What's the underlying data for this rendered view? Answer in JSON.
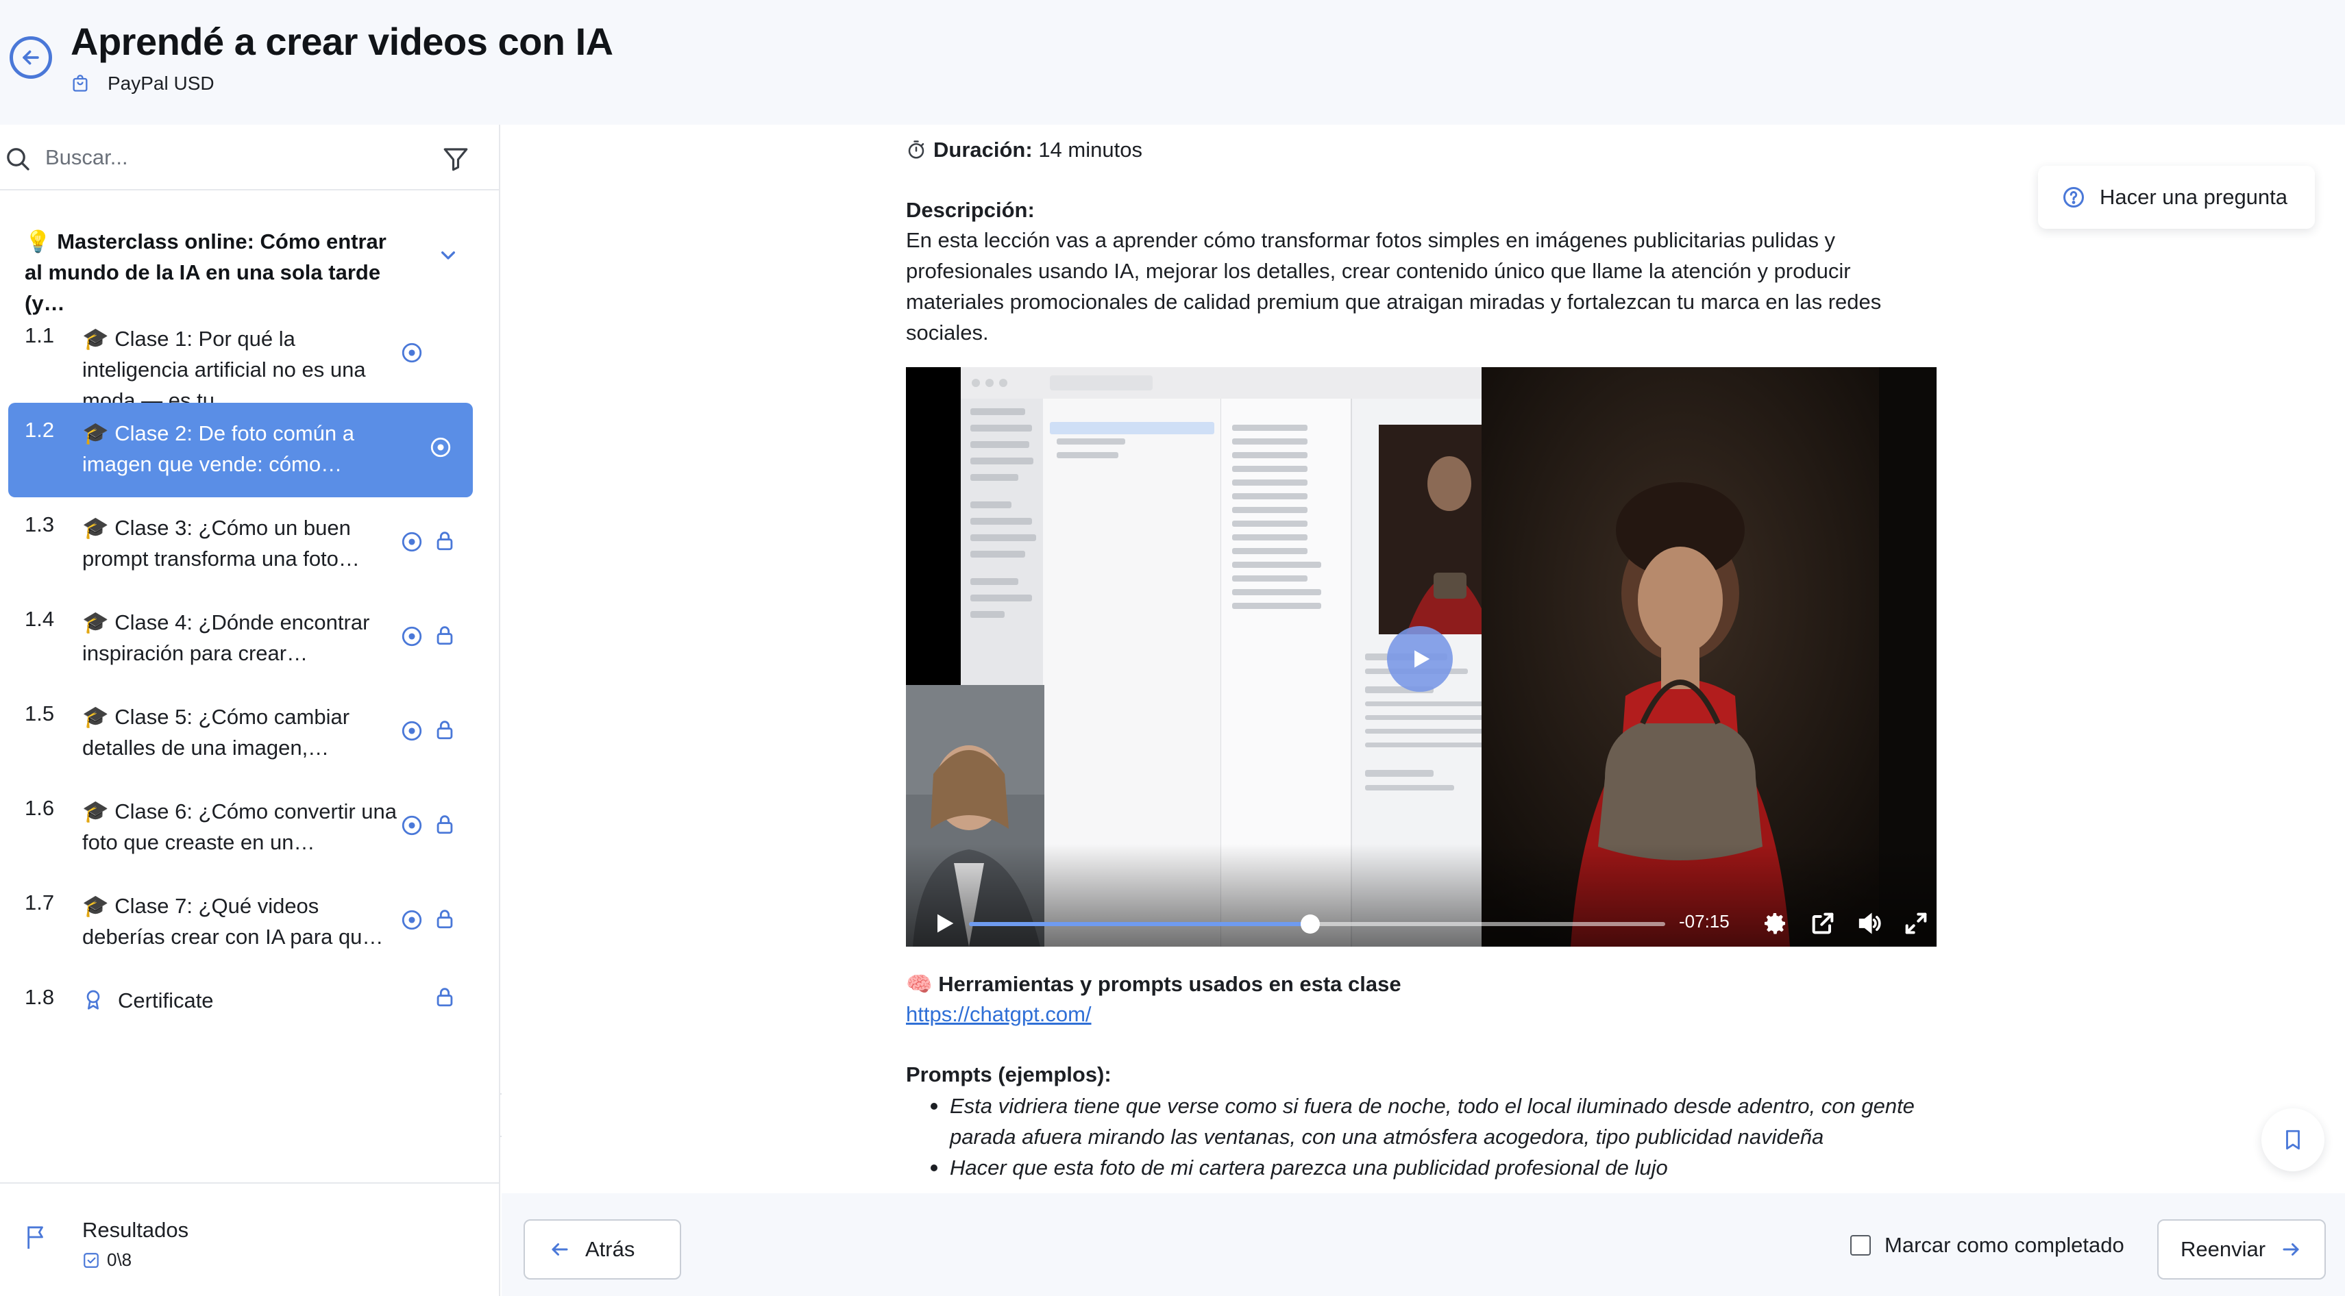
{
  "header": {
    "title": "Aprendé a crear videos con IA",
    "sponsor": "PayPal USD"
  },
  "sidebar": {
    "search_placeholder": "Buscar...",
    "module_title": "💡 Masterclass online: Cómo entrar al mundo de la IA en una sola tarde (y…",
    "lessons": [
      {
        "num": "1.1",
        "title": "🎓 Clase 1: Por qué la inteligencia artificial no es una moda — es tu…",
        "locked": false,
        "active": false
      },
      {
        "num": "1.2",
        "title": "🎓 Clase 2: De foto común a imagen que vende: cómo…",
        "locked": false,
        "active": true
      },
      {
        "num": "1.3",
        "title": "🎓 Clase 3: ¿Cómo un buen prompt transforma una foto…",
        "locked": true,
        "active": false
      },
      {
        "num": "1.4",
        "title": "🎓 Clase 4: ¿Dónde encontrar inspiración para crear…",
        "locked": true,
        "active": false
      },
      {
        "num": "1.5",
        "title": "🎓 Clase 5: ¿Cómo cambiar detalles de una imagen,…",
        "locked": true,
        "active": false
      },
      {
        "num": "1.6",
        "title": "🎓 Clase 6: ¿Cómo convertir una foto que creaste en un…",
        "locked": true,
        "active": false
      },
      {
        "num": "1.7",
        "title": "🎓 Clase 7: ¿Qué videos deberías crear con IA para qu…",
        "locked": true,
        "active": false
      },
      {
        "num": "1.8",
        "title": "Certificate",
        "locked": true,
        "active": false
      }
    ],
    "results_label": "Resultados",
    "results_count": "0\\8"
  },
  "lesson": {
    "duration_label": "Duración:",
    "duration_value": "14 minutos",
    "description_label": "Descripción:",
    "description": "En esta lección vas a aprender cómo transformar fotos simples en imágenes publicitarias pulidas y profesionales usando IA, mejorar los detalles, crear contenido único que llame la atención y producir materiales promocionales de calidad premium que atraigan miradas y fortalezcan tu marca en las redes sociales.",
    "video": {
      "time_remaining": "-07:15",
      "progress": 0.49
    },
    "tools_label": "🧠 Herramientas y prompts usados en esta clase",
    "tools_link": "https://chatgpt.com/",
    "prompts_label": "Prompts (ejemplos):",
    "prompts": [
      "Esta vidriera tiene que verse como si fuera de noche, todo el local iluminado desde adentro, con gente parada afuera mirando las ventanas, con una atmósfera acogedora, tipo publicidad navideña",
      "Hacer que esta foto de mi cartera parezca una publicidad profesional de lujo"
    ]
  },
  "actions": {
    "ask_question": "Hacer una pregunta",
    "back": "Atrás",
    "mark_complete": "Marcar como completado",
    "resend": "Reenviar"
  },
  "colors": {
    "accent": "#4a78d8",
    "active_lesson": "#5a8ee6",
    "header_bg": "#f6f8fc",
    "link": "#2f6fd6"
  },
  "icons": {
    "back": "back-arrow-circle-icon",
    "sponsor": "shopping-bag-icon",
    "search": "search-icon",
    "filter": "filter-icon",
    "chevron": "chevron-down-icon",
    "play": "play-circle-icon",
    "lock": "lock-icon",
    "flag": "flag-icon",
    "check": "checkbox-check-icon",
    "help": "question-circle-icon",
    "bookmark": "bookmark-icon"
  }
}
